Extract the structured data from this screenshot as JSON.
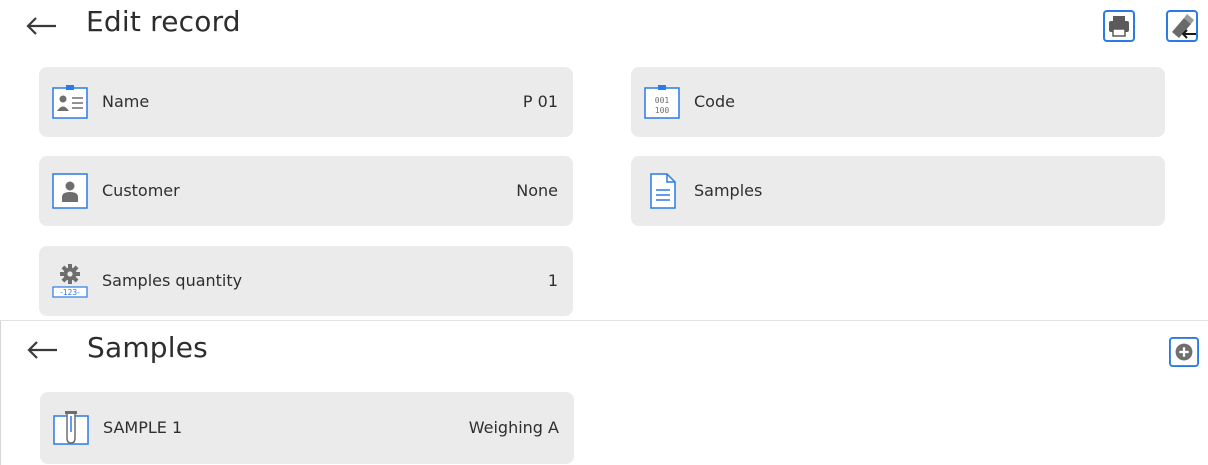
{
  "edit": {
    "title": "Edit record",
    "fields": {
      "name": {
        "label": "Name",
        "value": "P 01"
      },
      "code": {
        "label": "Code"
      },
      "customer": {
        "label": "Customer",
        "value": "None"
      },
      "samples": {
        "label": "Samples"
      },
      "samples_quantity": {
        "label": "Samples quantity",
        "value": "1"
      }
    },
    "toolbar": {
      "print_icon": "printer-icon",
      "export_icon": "usb-export-icon"
    }
  },
  "samples_panel": {
    "title": "Samples",
    "add_icon": "add-icon",
    "items": [
      {
        "name": "SAMPLE 1",
        "method": "Weighing A"
      }
    ]
  },
  "colors": {
    "accent_blue": "#2a7be4",
    "card_bg": "#ebebeb",
    "icon_gray": "#6e6e6e"
  }
}
